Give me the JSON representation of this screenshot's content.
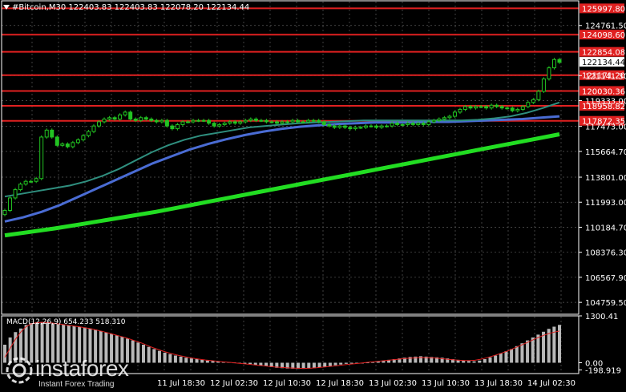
{
  "header": {
    "symbol_text": "#Bitcoin,M30  122403.83 122403.83 122078.20 122134.44"
  },
  "macd_label": "MACD(12,26,9) 654.233 518.310",
  "watermark": {
    "brand": "instaforex",
    "tagline": "Instant Forex Trading"
  },
  "colors": {
    "background": "#000000",
    "axis": "#ffffff",
    "grid": "#5a5a5a",
    "candle_up": "#22c322",
    "candle_down": "#22c322",
    "sma_fast": "#2f8f7f",
    "sma_mid": "#4a6cd4",
    "sma_slow": "#22dd22",
    "level_line": "#e02020",
    "level_label_bg": "#e02020",
    "price_label_bg": "#ffffff",
    "macd_hist": "#b8b8b8",
    "macd_signal": "#e02020"
  },
  "chart_data": {
    "type": "candlestick",
    "main": {
      "ylim": [
        103900,
        126600
      ],
      "y_ticks": [
        "124761.50",
        "121141.30",
        "119333.00",
        "117473.00",
        "115664.70",
        "113801.00",
        "111993.00",
        "110184.70",
        "108376.30",
        "106567.90",
        "104759.50"
      ],
      "y_tick_values": [
        124761.5,
        121141.3,
        119333.0,
        117473.0,
        115664.7,
        113801.0,
        111993.0,
        110184.7,
        108376.3,
        106567.9,
        104759.5
      ],
      "x_ticks": [
        "11 Jul 18:30",
        "12 Jul 02:30",
        "12 Jul 10:30",
        "12 Jul 18:30",
        "13 Jul 02:30",
        "13 Jul 10:30",
        "13 Jul 18:30",
        "14 Jul 02:30"
      ],
      "levels": [
        {
          "label": "125997.80",
          "value": 125997.8
        },
        {
          "label": "124098.60",
          "value": 124098.6
        },
        {
          "label": "122854.08",
          "value": 122854.08
        },
        {
          "label": "121171.20",
          "value": 121171.2
        },
        {
          "label": "120030.36",
          "value": 120030.36
        },
        {
          "label": "118958.82",
          "value": 118958.82
        },
        {
          "label": "117872.35",
          "value": 117872.35
        }
      ],
      "current_price": {
        "label": "122134.44",
        "value": 122134.44
      },
      "series_close": [
        111400,
        112300,
        112900,
        113300,
        113500,
        113500,
        113700,
        116700,
        117200,
        116700,
        116100,
        116200,
        116000,
        116300,
        116500,
        116800,
        117100,
        117500,
        117800,
        118000,
        118100,
        118000,
        118300,
        118500,
        118000,
        117900,
        118100,
        118000,
        117900,
        117800,
        117900,
        117500,
        117300,
        117600,
        117800,
        117800,
        117900,
        117900,
        117900,
        117700,
        117500,
        117600,
        117700,
        117800,
        117700,
        117800,
        117900,
        118000,
        117900,
        117900,
        117800,
        117800,
        117700,
        117800,
        117800,
        117900,
        117800,
        117800,
        117900,
        117900,
        117800,
        117600,
        117500,
        117400,
        117500,
        117400,
        117300,
        117400,
        117400,
        117500,
        117500,
        117400,
        117500,
        117500,
        117700,
        117600,
        117600,
        117700,
        117600,
        117700,
        117600,
        117800,
        117900,
        118000,
        118100,
        118200,
        118500,
        118700,
        118900,
        118800,
        118900,
        118900,
        118800,
        119000,
        118900,
        118800,
        118800,
        118600,
        118700,
        118900,
        119200,
        119400,
        120000,
        120900,
        121700,
        122300,
        122100
      ],
      "sma_fast": [
        112400,
        112600,
        112800,
        113000,
        113200,
        113500,
        113900,
        114400,
        115000,
        115600,
        116100,
        116500,
        116800,
        117000,
        117200,
        117400,
        117500,
        117600,
        117700,
        117750,
        117800,
        117850,
        117900,
        117900,
        117900,
        117900,
        117900,
        117900,
        117900,
        117950,
        118050,
        118200,
        118450,
        118800,
        119200
      ],
      "sma_mid": [
        110600,
        110900,
        111300,
        111800,
        112400,
        113000,
        113600,
        114200,
        114800,
        115300,
        115800,
        116200,
        116550,
        116850,
        117100,
        117300,
        117450,
        117550,
        117650,
        117700,
        117750,
        117750,
        117750,
        117800,
        117800,
        117850,
        117900,
        117950,
        118000,
        118100,
        118200
      ],
      "sma_slow": [
        109600,
        109850,
        110100,
        110400,
        110700,
        111000,
        111300,
        111650,
        112000,
        112350,
        112700,
        113050,
        113400,
        113750,
        114100,
        114450,
        114800,
        115150,
        115500,
        115850,
        116200,
        116550,
        116900
      ]
    },
    "macd": {
      "ylim": [
        -300,
        1300.41
      ],
      "y_ticks": [
        "1300.41",
        "0.00",
        "-198.919"
      ],
      "y_tick_values": [
        1300.41,
        0.0,
        -198.919
      ],
      "histogram": [
        500,
        700,
        850,
        950,
        1050,
        1100,
        1120,
        1130,
        1120,
        1100,
        1080,
        1060,
        1040,
        1020,
        1000,
        980,
        950,
        920,
        880,
        840,
        800,
        760,
        720,
        670,
        620,
        560,
        500,
        440,
        380,
        330,
        280,
        240,
        200,
        170,
        140,
        120,
        100,
        80,
        60,
        50,
        40,
        30,
        20,
        10,
        0,
        -20,
        -40,
        -60,
        -80,
        -100,
        -120,
        -140,
        -150,
        -160,
        -165,
        -170,
        -170,
        -160,
        -150,
        -130,
        -110,
        -90,
        -70,
        -50,
        -30,
        -20,
        -10,
        0,
        10,
        20,
        40,
        60,
        80,
        100,
        120,
        140,
        160,
        170,
        180,
        170,
        160,
        150,
        140,
        120,
        100,
        80,
        60,
        50,
        40,
        60,
        100,
        150,
        200,
        260,
        320,
        380,
        460,
        540,
        620,
        700,
        780,
        860,
        940,
        1000,
        1050
      ],
      "signal": [
        150,
        400,
        650,
        850,
        1000,
        1080,
        1110,
        1120,
        1115,
        1100,
        1080,
        1060,
        1040,
        1020,
        1000,
        975,
        950,
        920,
        885,
        850,
        810,
        770,
        730,
        690,
        640,
        590,
        540,
        480,
        420,
        370,
        320,
        275,
        235,
        200,
        170,
        140,
        115,
        95,
        75,
        60,
        45,
        30,
        15,
        5,
        -10,
        -25,
        -40,
        -55,
        -70,
        -85,
        -100,
        -115,
        -125,
        -135,
        -145,
        -150,
        -155,
        -155,
        -150,
        -140,
        -125,
        -110,
        -95,
        -80,
        -60,
        -45,
        -30,
        -15,
        0,
        15,
        30,
        45,
        60,
        75,
        90,
        105,
        120,
        130,
        140,
        145,
        140,
        135,
        125,
        110,
        95,
        80,
        70,
        60,
        60,
        70,
        95,
        130,
        170,
        215,
        265,
        315,
        375,
        440,
        505,
        570,
        635,
        700,
        760,
        810,
        850,
        880
      ]
    }
  }
}
